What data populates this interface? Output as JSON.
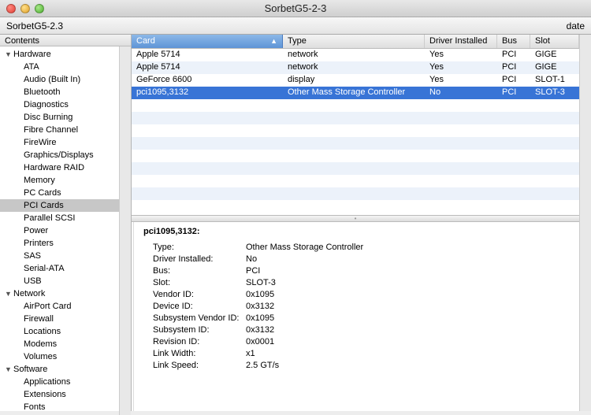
{
  "window": {
    "title": "SorbetG5-2-3"
  },
  "toolbar": {
    "left": "SorbetG5-2.3",
    "right": "date"
  },
  "sidebar": {
    "header": "Contents",
    "groups": [
      {
        "label": "Hardware",
        "items": [
          "ATA",
          "Audio (Built In)",
          "Bluetooth",
          "Diagnostics",
          "Disc Burning",
          "Fibre Channel",
          "FireWire",
          "Graphics/Displays",
          "Hardware RAID",
          "Memory",
          "PC Cards",
          "PCI Cards",
          "Parallel SCSI",
          "Power",
          "Printers",
          "SAS",
          "Serial-ATA",
          "USB"
        ],
        "selectedIndex": 11
      },
      {
        "label": "Network",
        "items": [
          "AirPort Card",
          "Firewall",
          "Locations",
          "Modems",
          "Volumes"
        ]
      },
      {
        "label": "Software",
        "items": [
          "Applications",
          "Extensions",
          "Fonts"
        ]
      }
    ]
  },
  "table": {
    "columns": [
      "Card",
      "Type",
      "Driver Installed",
      "Bus",
      "Slot"
    ],
    "sortedCol": 0,
    "rows": [
      {
        "card": "Apple 5714",
        "type": "network",
        "driver": "Yes",
        "bus": "PCI",
        "slot": "GIGE"
      },
      {
        "card": "Apple 5714",
        "type": "network",
        "driver": "Yes",
        "bus": "PCI",
        "slot": "GIGE"
      },
      {
        "card": "GeForce 6600",
        "type": "display",
        "driver": "Yes",
        "bus": "PCI",
        "slot": "SLOT-1"
      },
      {
        "card": "pci1095,3132",
        "type": "Other Mass Storage Controller",
        "driver": "No",
        "bus": "PCI",
        "slot": "SLOT-3"
      }
    ],
    "selectedIndex": 3
  },
  "detail": {
    "title": "pci1095,3132:",
    "fields": [
      {
        "k": "Type:",
        "v": "Other Mass Storage Controller"
      },
      {
        "k": "Driver Installed:",
        "v": "No"
      },
      {
        "k": "Bus:",
        "v": "PCI"
      },
      {
        "k": "Slot:",
        "v": "SLOT-3"
      },
      {
        "k": "Vendor ID:",
        "v": "0x1095"
      },
      {
        "k": "Device ID:",
        "v": "0x3132"
      },
      {
        "k": "Subsystem Vendor ID:",
        "v": "0x1095"
      },
      {
        "k": "Subsystem ID:",
        "v": "0x3132"
      },
      {
        "k": "Revision ID:",
        "v": "0x0001"
      },
      {
        "k": "Link Width:",
        "v": "x1"
      },
      {
        "k": "Link Speed:",
        "v": "2.5 GT/s"
      }
    ]
  }
}
